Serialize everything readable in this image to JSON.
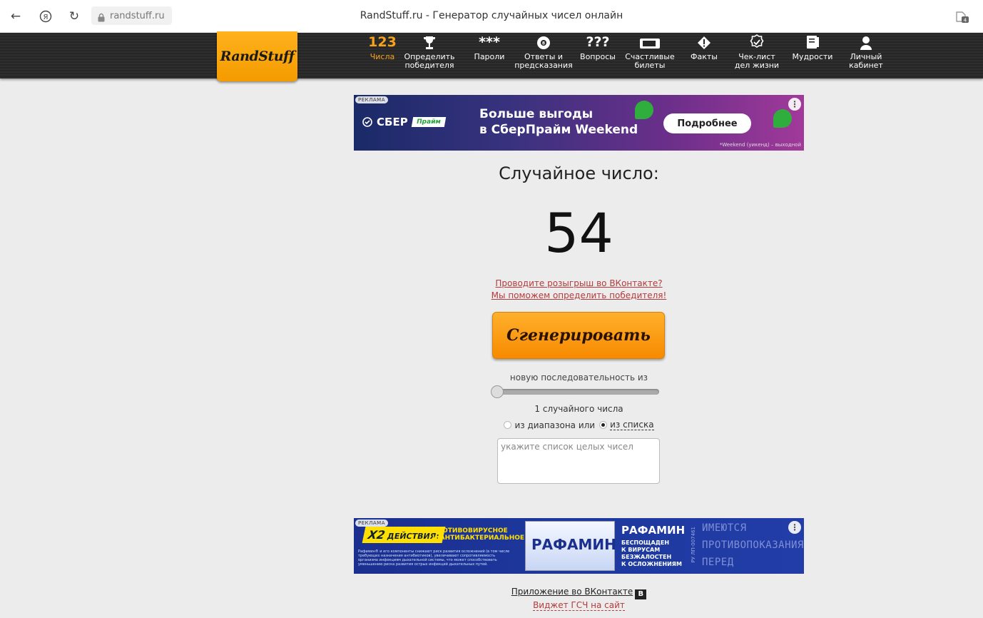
{
  "browser": {
    "url": "randstuff.ru",
    "title": "RandStuff.ru - Генератор случайных чисел онлайн",
    "ext_count": "4"
  },
  "logo": "RandStuff",
  "nav": [
    {
      "icon": "123",
      "label": "Числа"
    },
    {
      "icon": "trophy-icon",
      "label": "Определить\nпобедителя"
    },
    {
      "icon": "***",
      "label": "Пароли"
    },
    {
      "icon": "8",
      "label": "Ответы и\nпредсказания"
    },
    {
      "icon": "???",
      "label": "Вопросы"
    },
    {
      "icon": "ticket-icon",
      "label": "Счастливые\nбилеты"
    },
    {
      "icon": "exclamation-icon",
      "label": "Факты"
    },
    {
      "icon": "check-icon",
      "label": "Чек-лист\nдел жизни"
    },
    {
      "icon": "book-icon",
      "label": "Мудрости"
    },
    {
      "icon": "user-icon",
      "label": "Личный\nкабинет"
    }
  ],
  "ad_top": {
    "badge": "РЕКЛАМА",
    "brand": "СБЕР",
    "brand_tag": "Прайм",
    "text_line1": "Больше выгоды",
    "text_line2": "в СберПрайм Weekend",
    "button": "Подробнее",
    "note": "*Weekend (уикенд) – выходной",
    "menu": "⋮"
  },
  "generator": {
    "heading": "Случайное число:",
    "number": "54",
    "vk_line1": "Проводите розыгрыш во ВКонтакте?",
    "vk_line2": "Мы поможем определить победителя!",
    "button": "Сгенерировать",
    "sequence_label": "новую последовательность из",
    "count_label": "1 случайного числа",
    "mode_range": "из диапазона или",
    "mode_list": "из списка",
    "list_placeholder": "укажите список целых чисел"
  },
  "ad_bottom": {
    "badge": "РЕКЛАМА",
    "x2": "X2",
    "x2_text": "ДЕЙСТВИЯ:",
    "headline1": "ПРОТИВОВИРУСНОЕ",
    "headline2": "И АНТИБАКТЕРИАЛЬНОЕ",
    "small_text": "Рафамин® и его компоненты снижают риск развития осложнений (в том числе требующих назначения антибиотиков), увеличивают сопротивляемость организма инфекциям дыхательной системы, что может способствовать уменьшению риска развития острых инфекций дыхательных путей.",
    "product": "РАФАМИН",
    "brand": "РАФАМИН",
    "sub1": "БЕСПОЩАДЕН",
    "sub2": "К ВИРУСАМ",
    "sub3": "БЕЗЖАЛОСТЕН",
    "sub4": "К ОСЛОЖНЕНИЯМ",
    "reg": "РУ ЛП-007461",
    "warning": "ИМЕЮТСЯ ПРОТИВОПОКАЗАНИЯ ПЕРЕД ПРИМЕНЕНИЕМ ОЗНАКОМЬТЕСЬ С ИНСТРУКЦИЕЙ",
    "menu": "⋮"
  },
  "footer": {
    "vk_app": "Приложение во ВКонтакте",
    "vk_badge": "В",
    "widget": "Виджет ГСЧ на сайт"
  },
  "colors": {
    "accent": "#f7a21b",
    "link": "#b53a3a"
  }
}
